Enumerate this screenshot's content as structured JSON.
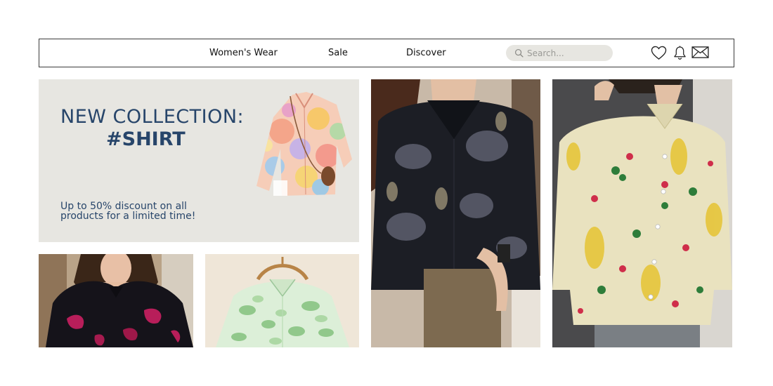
{
  "nav": {
    "links": [
      "Women's Wear",
      "Sale",
      "Discover"
    ],
    "search_placeholder": "Search...",
    "icons": [
      "heart-icon",
      "bell-icon",
      "mail-icon"
    ]
  },
  "banner": {
    "title": "NEW COLLECTION:",
    "tag": "#SHIRT",
    "subtitle": "Up to 50% discount on all products for a limited time!"
  },
  "colors": {
    "accent": "#27456a",
    "banner_bg": "#e7e6e1",
    "search_bg": "#e7e6e1"
  }
}
